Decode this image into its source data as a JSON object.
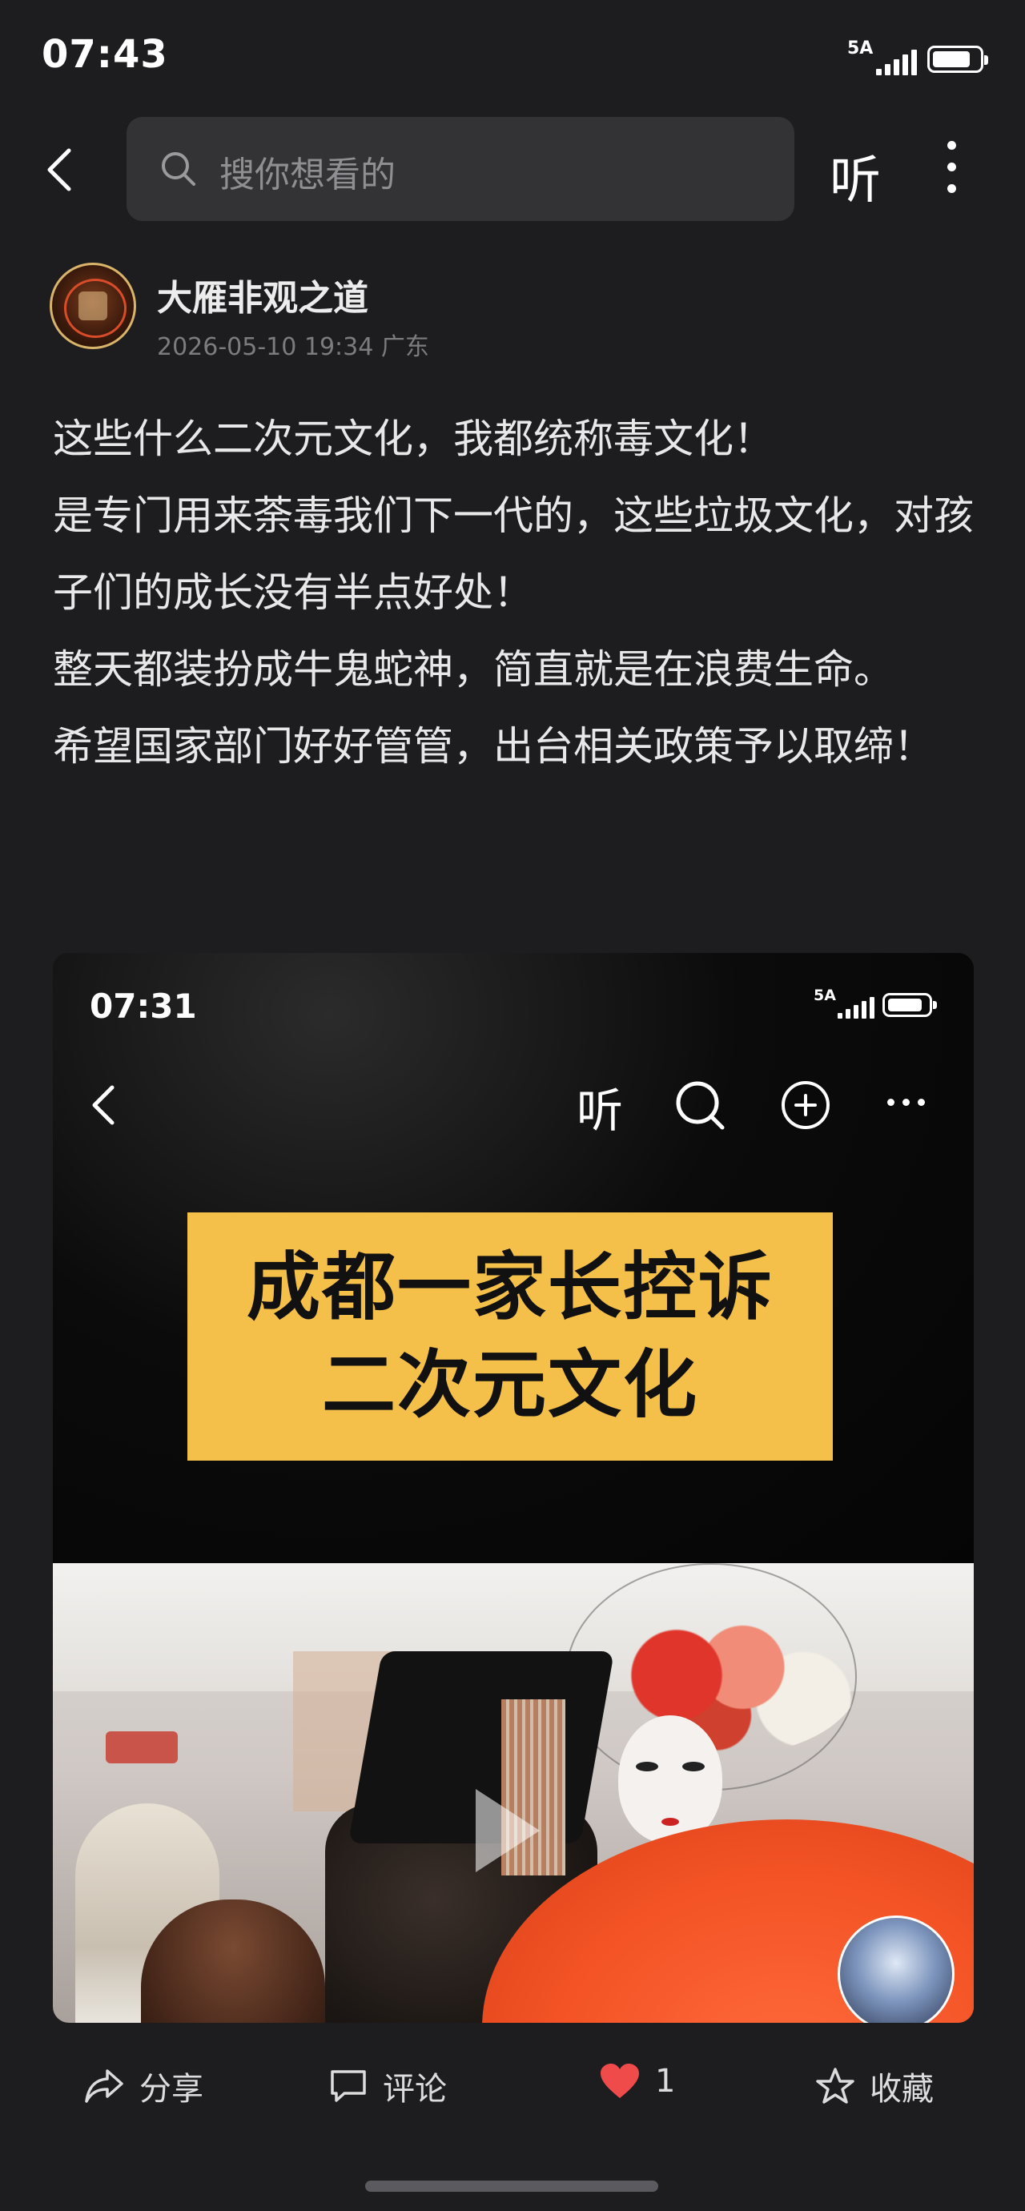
{
  "status_bar": {
    "time": "07:43",
    "network": "5A",
    "battery_percent": 70
  },
  "nav": {
    "search_placeholder": "搜你想看的",
    "listen_label": "听"
  },
  "author": {
    "name": "大雁非观之道",
    "meta": "2026-05-10 19:34 广东"
  },
  "post": {
    "paragraphs": [
      "这些什么二次元文化，我都统称毒文化！",
      "是专门用来荼毒我们下一代的，这些垃圾文化，对孩子们的成长没有半点好处！",
      "整天都装扮成牛鬼蛇神，简直就是在浪费生命。",
      "希望国家部门好好管管，出台相关政策予以取缔！"
    ]
  },
  "embedded": {
    "time": "07:31",
    "network": "5A",
    "battery_percent": 75,
    "listen_label": "听",
    "banner": {
      "line1": "成都一家长控诉",
      "line2": "二次元文化",
      "color": "#f5c04a"
    }
  },
  "actions": {
    "share": "分享",
    "comment": "评论",
    "like_count": "1",
    "favorite": "收藏",
    "like_color": "#f04b4b"
  }
}
